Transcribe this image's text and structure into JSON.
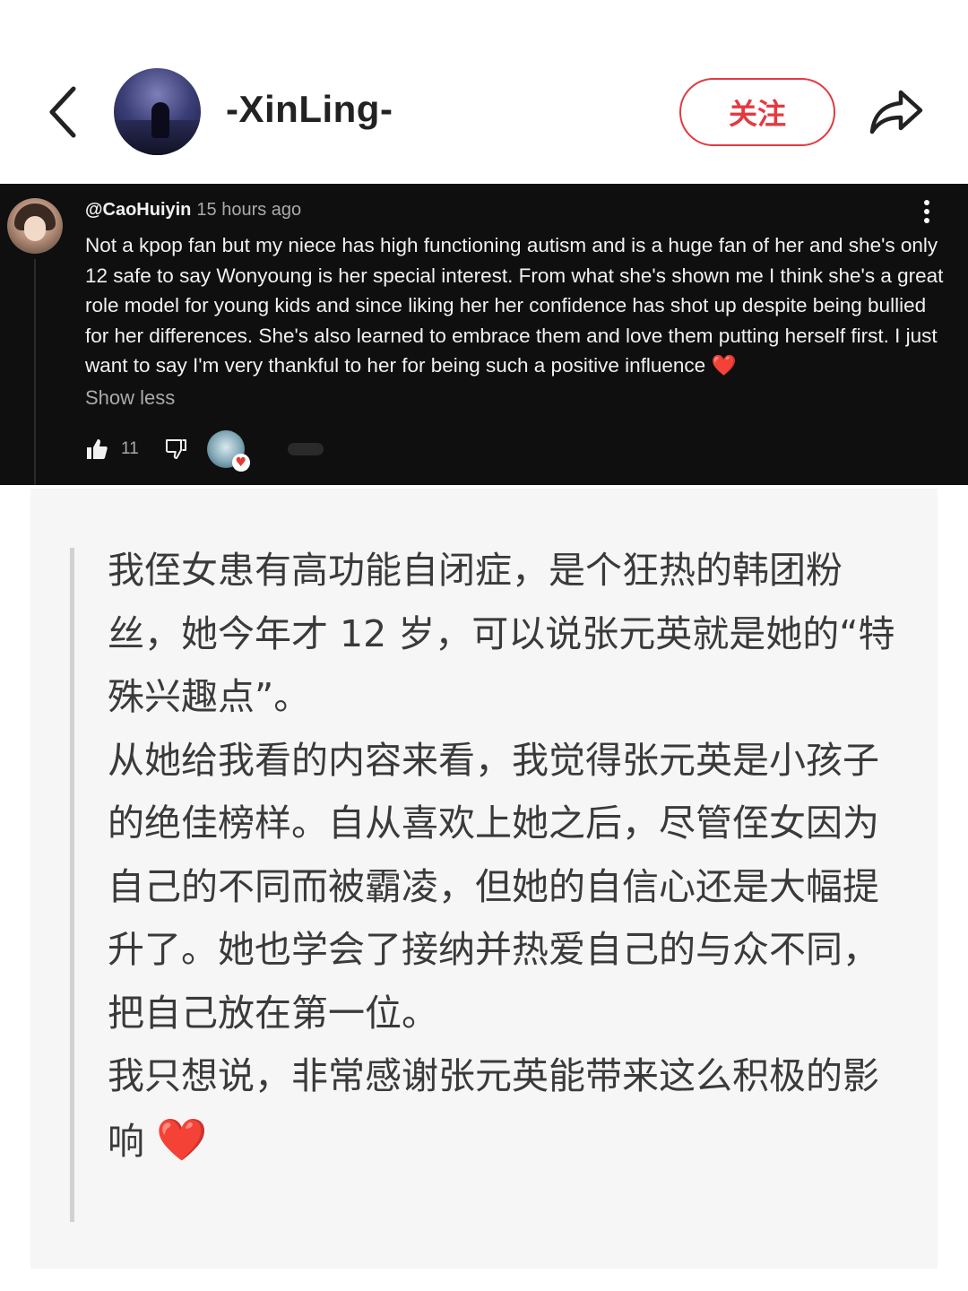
{
  "header": {
    "back_icon": "chevron-left-icon",
    "username": "-XinLing-",
    "follow_label": "关注",
    "share_icon": "share-arrow-icon",
    "accent_color": "#e5393f"
  },
  "comment": {
    "handle": "@CaoHuiyin",
    "time": "15 hours ago",
    "text": "Not a kpop fan but my niece has high functioning autism and is a huge fan of her and she's only 12 safe to say Wonyoung is her special interest. From what she's shown me I think she's a great role model for young kids and since liking her her confidence has shot up despite being bullied for her differences. She's also learned to embrace them and love them putting herself first. I just want to say I'm very thankful to her for being such a positive influence",
    "heart": "❤️",
    "show_less": "Show less",
    "like_count": "11",
    "icons": [
      "thumbs-up-icon",
      "thumbs-down-icon",
      "kebab-menu-icon",
      "creator-heart-icon"
    ]
  },
  "translation": {
    "text": "我侄女患有高功能自闭症，是个狂热的韩团粉丝，她今年才 12 岁，可以说张元英就是她的“特殊兴趣点”。\n从她给我看的内容来看，我觉得张元英是小孩子的绝佳榜样。自从喜欢上她之后，尽管侄女因为自己的不同而被霸凌，但她的自信心还是大幅提升了。她也学会了接纳并热爱自己的与众不同，把自己放在第一位。\n我只想说，非常感谢张元英能带来这么积极的影响",
    "heart": "❤️"
  }
}
